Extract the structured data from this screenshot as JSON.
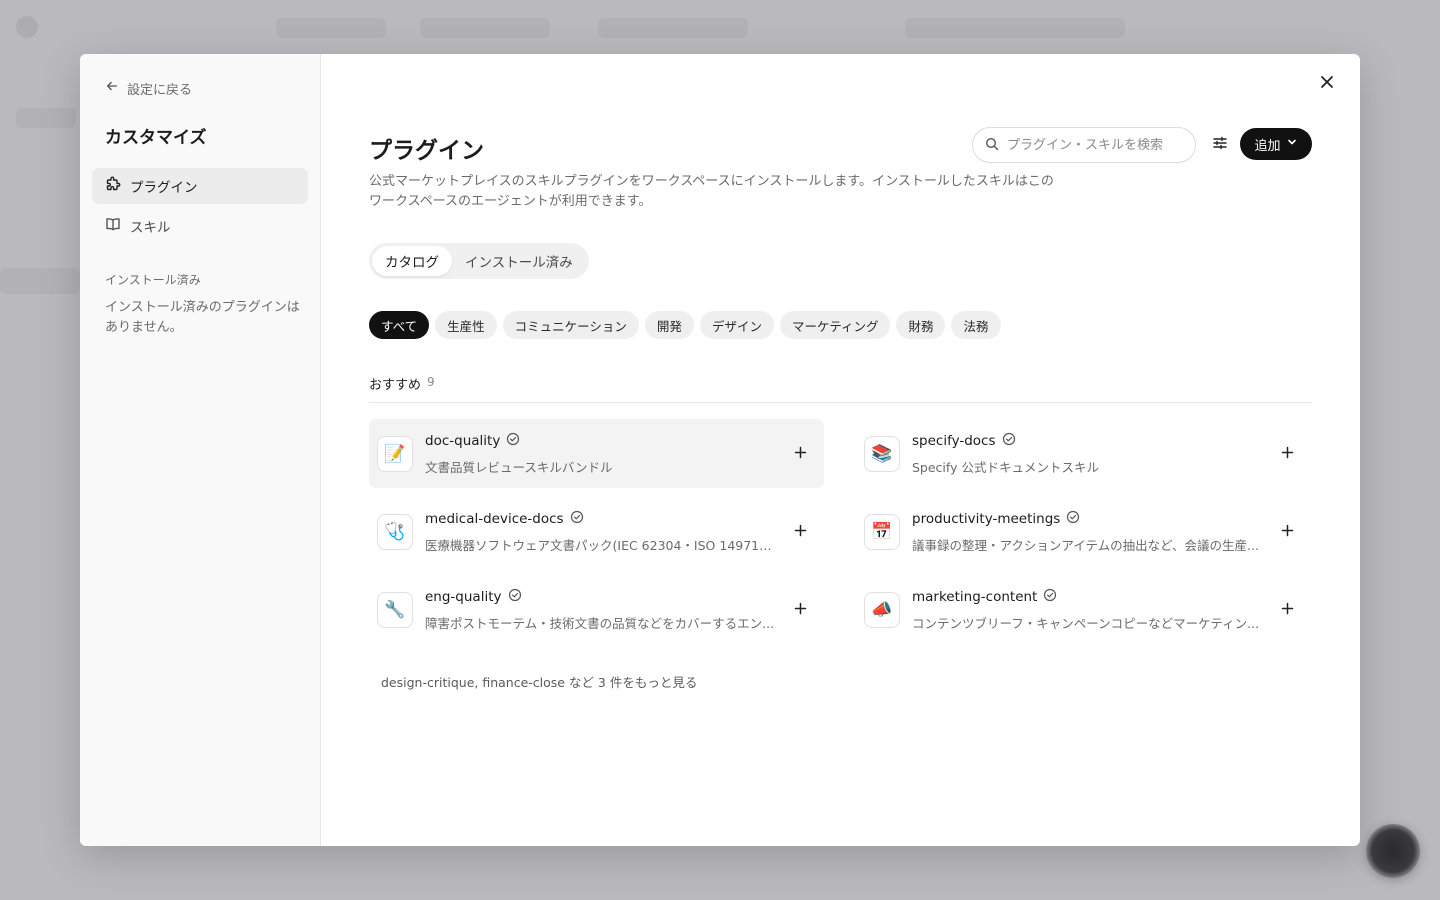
{
  "sidebar": {
    "back_label": "設定に戻る",
    "title": "カスタマイズ",
    "items": [
      {
        "label": "プラグイン",
        "icon": "puzzle-icon",
        "active": true
      },
      {
        "label": "スキル",
        "icon": "book-icon",
        "active": false
      }
    ],
    "installed_section": "インストール済み",
    "installed_empty": "インストール済みのプラグインはありません。"
  },
  "header": {
    "title": "プラグイン",
    "search_placeholder": "プラグイン・スキルを検索",
    "add_label": "追加",
    "description": "公式マーケットプレイスのスキルプラグインをワークスペースにインストールします。インストールしたスキルはこのワークスペースのエージェントが利用できます。"
  },
  "tabs": [
    {
      "label": "カタログ",
      "active": true
    },
    {
      "label": "インストール済み",
      "active": false
    }
  ],
  "categories": [
    {
      "label": "すべて",
      "active": true
    },
    {
      "label": "生産性",
      "active": false
    },
    {
      "label": "コミュニケーション",
      "active": false
    },
    {
      "label": "開発",
      "active": false
    },
    {
      "label": "デザイン",
      "active": false
    },
    {
      "label": "マーケティング",
      "active": false
    },
    {
      "label": "財務",
      "active": false
    },
    {
      "label": "法務",
      "active": false
    }
  ],
  "section": {
    "title": "おすすめ",
    "count": "9"
  },
  "plugins": [
    {
      "name": "doc-quality",
      "description": "文書品質レビュースキルバンドル",
      "icon": "📝"
    },
    {
      "name": "specify-docs",
      "description": "Specify 公式ドキュメントスキル",
      "icon": "📚"
    },
    {
      "name": "medical-device-docs",
      "description": "医療機器ソフトウェア文書パック(IEC 62304・ISO 14971) ...",
      "icon": "🩺"
    },
    {
      "name": "productivity-meetings",
      "description": "議事録の整理・アクションアイテムの抽出など、会議の生産...",
      "icon": "📅"
    },
    {
      "name": "eng-quality",
      "description": "障害ポストモーテム・技術文書の品質などをカバーするエン...",
      "icon": "🔧"
    },
    {
      "name": "marketing-content",
      "description": "コンテンツブリーフ・キャンペーンコピーなどマーケティン...",
      "icon": "📣"
    }
  ],
  "more_link": "design-critique, finance-close など 3 件をもっと見る",
  "colors": {
    "accent": "#111111",
    "chip_bg": "#efefef",
    "muted_text": "#6b6b6b"
  }
}
